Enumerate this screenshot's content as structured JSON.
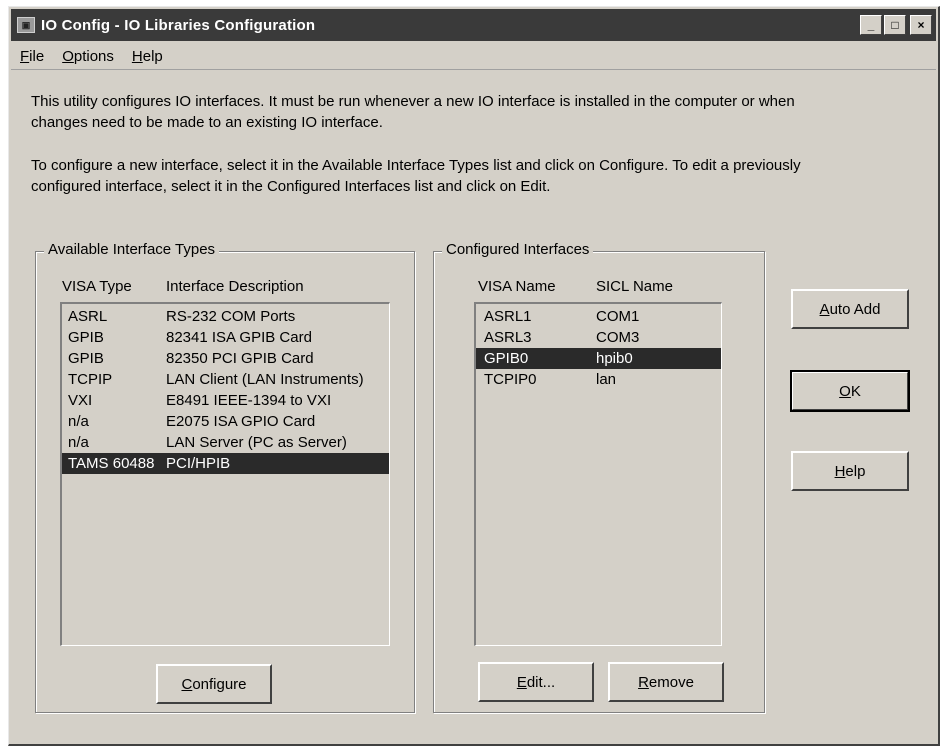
{
  "window": {
    "icon": "io-config-app-icon",
    "title": "IO Config - IO Libraries Configuration",
    "minimize": "_",
    "maximize": "□",
    "close": "×"
  },
  "menu": [
    "File",
    "Options",
    "Help"
  ],
  "description": {
    "p1_line1": "This utility configures IO interfaces.  It must be run whenever a new IO interface is installed in the computer or when",
    "p1_line2": "changes need to be made to an existing IO interface.",
    "p2_line1": "To configure a new interface, select it in the Available Interface Types list and click on Configure.  To edit a previously",
    "p2_line2": "configured interface, select it in the Configured Interfaces list and click on Edit."
  },
  "available": {
    "group_label": "Available Interface Types",
    "col_type": "VISA Type",
    "col_desc": "Interface Description",
    "rows": [
      {
        "type": "ASRL",
        "desc": "RS-232 COM Ports"
      },
      {
        "type": "GPIB",
        "desc": "82341 ISA GPIB Card"
      },
      {
        "type": "GPIB",
        "desc": "82350 PCI GPIB Card"
      },
      {
        "type": "TCPIP",
        "desc": "LAN Client (LAN Instruments)"
      },
      {
        "type": "VXI",
        "desc": "E8491 IEEE-1394 to VXI"
      },
      {
        "type": "n/a",
        "desc": "E2075 ISA GPIO Card"
      },
      {
        "type": "n/a",
        "desc": "LAN Server (PC as Server)"
      },
      {
        "type": "TAMS 60488",
        "desc": "PCI/HPIB"
      }
    ],
    "selected_index": 7,
    "configure_button": "Configure"
  },
  "configured": {
    "group_label": "Configured Interfaces",
    "col_visa": "VISA Name",
    "col_sicl": "SICL Name",
    "rows": [
      {
        "visa": "ASRL1",
        "sicl": "COM1"
      },
      {
        "visa": "ASRL3",
        "sicl": "COM3"
      },
      {
        "visa": "GPIB0",
        "sicl": "hpib0"
      },
      {
        "visa": "TCPIP0",
        "sicl": "lan"
      }
    ],
    "selected_index": 2,
    "edit_button": "Edit...",
    "remove_button": "Remove"
  },
  "side_buttons": {
    "auto_add": "Auto Add",
    "ok": "OK",
    "help": "Help"
  },
  "colors": {
    "selection_bg": "#2a2a2a",
    "dialog_bg": "#d4d0c8",
    "title_bg": "#3a3a3a"
  }
}
